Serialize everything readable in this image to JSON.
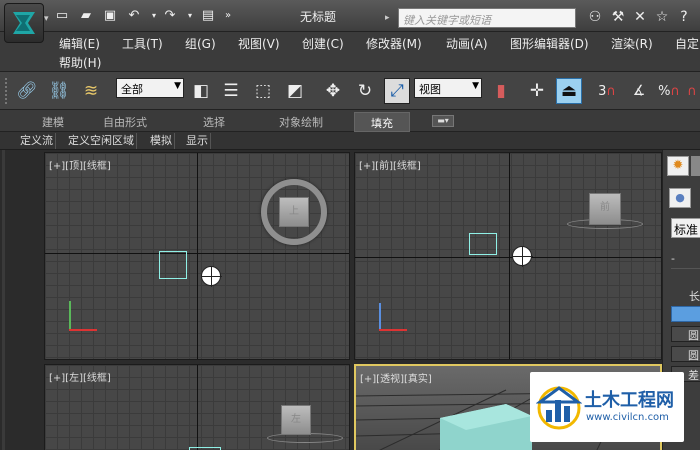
{
  "app": {
    "title": "无标题",
    "search_placeholder": "键入关键字或短语"
  },
  "quick_access": [
    "new-file-icon",
    "open-folder-icon",
    "save-icon",
    "undo-icon",
    "redo-icon",
    "project-icon"
  ],
  "menu": [
    {
      "label": "编辑(E)"
    },
    {
      "label": "工具(T)"
    },
    {
      "label": "组(G)"
    },
    {
      "label": "视图(V)"
    },
    {
      "label": "创建(C)"
    },
    {
      "label": "修改器(M)"
    },
    {
      "label": "动画(A)"
    },
    {
      "label": "图形编辑器(D)"
    },
    {
      "label": "渲染(R)"
    },
    {
      "label": "自定"
    },
    {
      "label": "帮助(H)"
    }
  ],
  "toolbar": {
    "selection_filter": "全部",
    "ref_coord": "视图",
    "snap_label": "3",
    "angle_snap": "%"
  },
  "ribbon_tabs": [
    {
      "label": "建模"
    },
    {
      "label": "自由形式"
    },
    {
      "label": "选择"
    },
    {
      "label": "对象绘制"
    },
    {
      "label": "填充"
    }
  ],
  "sub_tabs": [
    {
      "label": "定义流"
    },
    {
      "label": "定义空闲区域"
    },
    {
      "label": "模拟"
    },
    {
      "label": "显示"
    }
  ],
  "viewports": [
    {
      "label": "[+][顶][线框]",
      "cube_text": "上"
    },
    {
      "label": "[+][前][线框]",
      "cube_text": "前"
    },
    {
      "label": "[+][左][线框]",
      "cube_text": "左"
    },
    {
      "label": "[+][透视][真实]",
      "cube_text": ""
    }
  ],
  "right_panel": {
    "standard": "标准",
    "labels": [
      "长",
      "圆",
      "圆",
      "差"
    ]
  },
  "watermark": {
    "title": "土木工程网",
    "url": "www.civilcn.com"
  },
  "colors": {
    "accent_selected": "#9cd1f0",
    "selection_box": "#8ff0e6",
    "watermark_blue": "#1f5fa8"
  }
}
